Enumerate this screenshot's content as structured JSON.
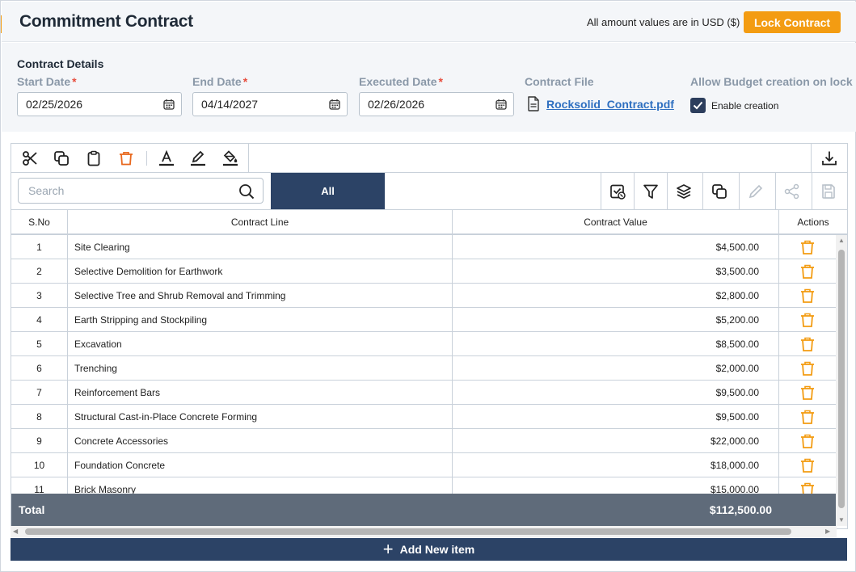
{
  "header": {
    "title": "Commitment Contract",
    "currency_note": "All amount values are in USD ($)",
    "lock_button": "Lock Contract"
  },
  "details": {
    "section_title": "Contract Details",
    "start_date": {
      "label": "Start Date",
      "value": "02/25/2026"
    },
    "end_date": {
      "label": "End Date",
      "value": "04/14/2027"
    },
    "executed_date": {
      "label": "Executed Date",
      "value": "02/26/2026"
    },
    "contract_file": {
      "label": "Contract File",
      "name": "Rocksolid_Contract.pdf"
    },
    "budget": {
      "label": "Allow Budget creation on lock",
      "checkbox_label": "Enable creation",
      "checked": true
    }
  },
  "toolbar": {
    "icons": [
      "cut-icon",
      "copy-icon",
      "paste-icon",
      "delete-icon",
      "font-color-icon",
      "highlight-icon",
      "fill-color-icon",
      "download-icon"
    ]
  },
  "filter": {
    "search_placeholder": "Search",
    "tab_all": "All"
  },
  "table": {
    "headers": {
      "sno": "S.No",
      "line": "Contract Line",
      "value": "Contract Value",
      "actions": "Actions"
    },
    "rows": [
      {
        "sno": "1",
        "line": "Site Clearing",
        "value": "$4,500.00"
      },
      {
        "sno": "2",
        "line": "Selective Demolition for Earthwork",
        "value": "$3,500.00"
      },
      {
        "sno": "3",
        "line": "Selective Tree and Shrub Removal and Trimming",
        "value": "$2,800.00"
      },
      {
        "sno": "4",
        "line": "Earth Stripping and Stockpiling",
        "value": "$5,200.00"
      },
      {
        "sno": "5",
        "line": "Excavation",
        "value": "$8,500.00"
      },
      {
        "sno": "6",
        "line": "Trenching",
        "value": "$2,000.00"
      },
      {
        "sno": "7",
        "line": "Reinforcement Bars",
        "value": "$9,500.00"
      },
      {
        "sno": "8",
        "line": "Structural Cast-in-Place Concrete Forming",
        "value": "$9,500.00"
      },
      {
        "sno": "9",
        "line": "Concrete Accessories",
        "value": "$22,000.00"
      },
      {
        "sno": "10",
        "line": "Foundation Concrete",
        "value": "$18,000.00"
      },
      {
        "sno": "11",
        "line": "Brick Masonry",
        "value": "$15,000.00"
      }
    ],
    "total_label": "Total",
    "total_value": "$112,500.00"
  },
  "add_button": "Add New item",
  "colors": {
    "accent": "#f39c12",
    "navy": "#2c4366",
    "total_bar": "#5f6b7a",
    "link": "#2e6fc0"
  }
}
